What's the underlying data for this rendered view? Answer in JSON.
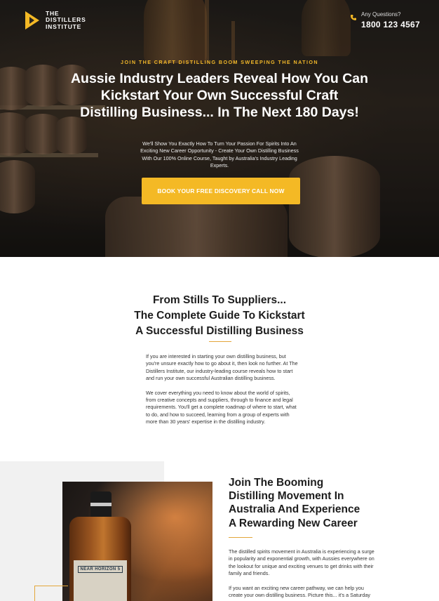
{
  "header": {
    "logo_lines": [
      "THE",
      "DISTILLERS",
      "INSTITUTE"
    ],
    "contact_question": "Any Questions?",
    "contact_phone": "1800 123 4567"
  },
  "hero": {
    "kicker": "JOIN THE CRAFT DISTILLING BOOM SWEEPING THE NATION",
    "title": "Aussie Industry Leaders Reveal How You Can Kickstart Your Own Successful Craft Distilling Business... In The Next 180 Days!",
    "subtitle": "We'll Show You Exactly How To Turn Your Passion For Spirits Into An Exciting New Career Opportunity - Create Your Own Distilling Business With Our 100% Online Course, Taught by Australia's Industry Leading Experts.",
    "cta_label": "BOOK YOUR FREE DISCOVERY CALL NOW"
  },
  "guide": {
    "title_lines": [
      "From Stills To Suppliers...",
      "The Complete Guide To Kickstart",
      "A Successful Distilling Business"
    ],
    "paragraphs": [
      "If you are interested in starting your own distilling business, but you're unsure exactly how to go about it, then look no further. At The Distillers Institute, our industry-leading course reveals how to start and run your own successful Australian distilling business.",
      "We cover everything you need to know about the world of spirits, from creative concepts and suppliers, through to finance and legal requirements. You'll get a complete roadmap of where to start, what to do, and how to succeed, learning from a group of experts with more than 30 years' expertise in the distilling industry."
    ]
  },
  "movement": {
    "title_lines": [
      "Join The Booming",
      "Distilling Movement In",
      "Australia And Experience",
      "A Rewarding New Career"
    ],
    "bottle_label": "NEAR HORIZON 5",
    "paragraphs": [
      "The distilled spirits movement in Australia is experiencing a surge in popularity and exponential growth, with Aussies everywhere on the lookout for unique and exciting venues to get drinks with their family and friends.",
      "If you want an exciting new career pathway, we can help you create your own distilling business. Picture this... it's a Saturday"
    ]
  },
  "colors": {
    "accent": "#f4b925",
    "kicker": "#f1b72a",
    "divider": "#e3a63a"
  }
}
